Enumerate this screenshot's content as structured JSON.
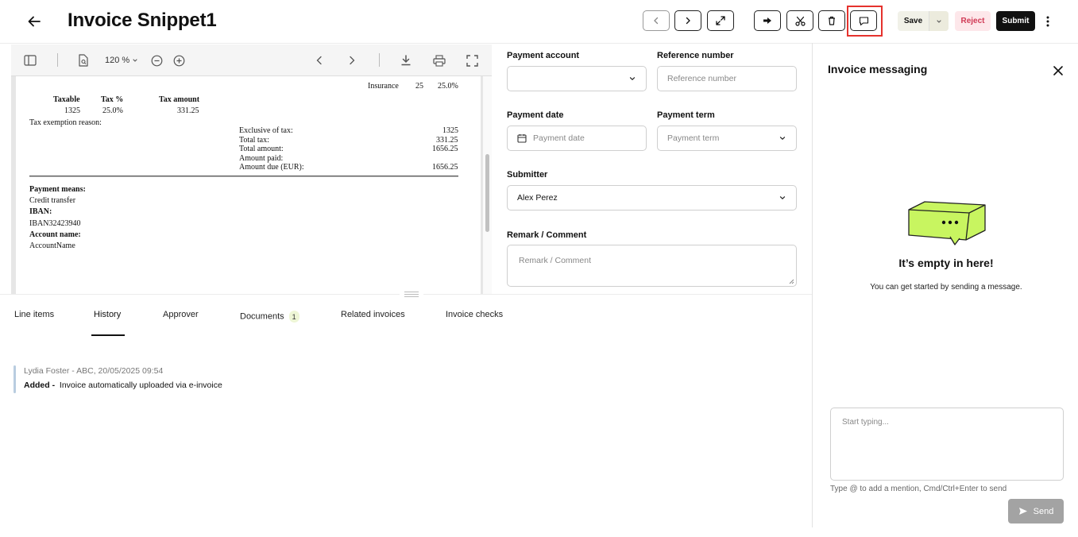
{
  "header": {
    "title": "Invoice Snippet1",
    "save_label": "Save",
    "reject_label": "Reject",
    "submit_label": "Submit"
  },
  "pdf": {
    "zoom": "120 %",
    "lines": {
      "insurance_label": "Insurance",
      "insurance_qty": "25",
      "insurance_pct": "25.0%",
      "taxable_h": "Taxable",
      "taxpct_h": "Tax %",
      "taxamt_h": "Tax amount",
      "taxable_v": "1325",
      "taxpct_v": "25.0%",
      "taxamt_v": "331.25",
      "exemption": "Tax exemption reason:",
      "excl_label": "Exclusive of tax:",
      "excl_value": "1325",
      "totaltax_label": "Total tax:",
      "totaltax_value": "331.25",
      "totalamt_label": "Total amount:",
      "totalamt_value": "1656.25",
      "paid_label": "Amount paid:",
      "due_label": "Amount due (EUR):",
      "due_value": "1656.25",
      "payment_means_h": "Payment means:",
      "payment_means_v": "Credit transfer",
      "iban_h": "IBAN:",
      "iban_v": "IBAN32423940",
      "account_h": "Account name:",
      "account_v": "AccountName"
    }
  },
  "form": {
    "payment_account_label": "Payment account",
    "payment_account_value": "",
    "reference_number_label": "Reference number",
    "reference_number_placeholder": "Reference number",
    "payment_date_label": "Payment date",
    "payment_date_placeholder": "Payment date",
    "payment_term_label": "Payment term",
    "payment_term_placeholder": "Payment term",
    "submitter_label": "Submitter",
    "submitter_value": "Alex Perez",
    "remark_label": "Remark / Comment",
    "remark_placeholder": "Remark / Comment"
  },
  "tabs": {
    "line_items": "Line items",
    "history": "History",
    "approver": "Approver",
    "documents": "Documents",
    "documents_count": "1",
    "related_invoices": "Related invoices",
    "invoice_checks": "Invoice checks",
    "active": "History"
  },
  "history": {
    "entries": [
      {
        "meta": "Lydia Foster - ABC, 20/05/2025 09:54",
        "action": "Added -",
        "text": "Invoice automatically uploaded via e-invoice"
      }
    ]
  },
  "messaging": {
    "title": "Invoice messaging",
    "empty_title": "It’s empty in here!",
    "empty_sub": "You can get started by sending a message.",
    "input_placeholder": "Start typing...",
    "hint": "Type @ to add a mention, Cmd/Ctrl+Enter to send",
    "send_label": "Send"
  },
  "colors": {
    "accent_outline": "#e5322d",
    "reject_text": "#d03a55",
    "reject_bg": "#fde7ea",
    "submit_bg": "#111111",
    "illustration": "#c8f560"
  },
  "icons": [
    "back-arrow-icon",
    "chevron-left-icon",
    "chevron-right-icon",
    "expand-icon",
    "forward-icon",
    "scissors-icon",
    "trash-icon",
    "message-icon",
    "kebab-icon",
    "sidebar-toggle-icon",
    "document-search-icon",
    "zoom-out-icon",
    "zoom-in-icon",
    "download-icon",
    "print-icon",
    "fullscreen-icon",
    "calendar-icon",
    "chevron-down-icon",
    "close-icon",
    "send-icon"
  ]
}
